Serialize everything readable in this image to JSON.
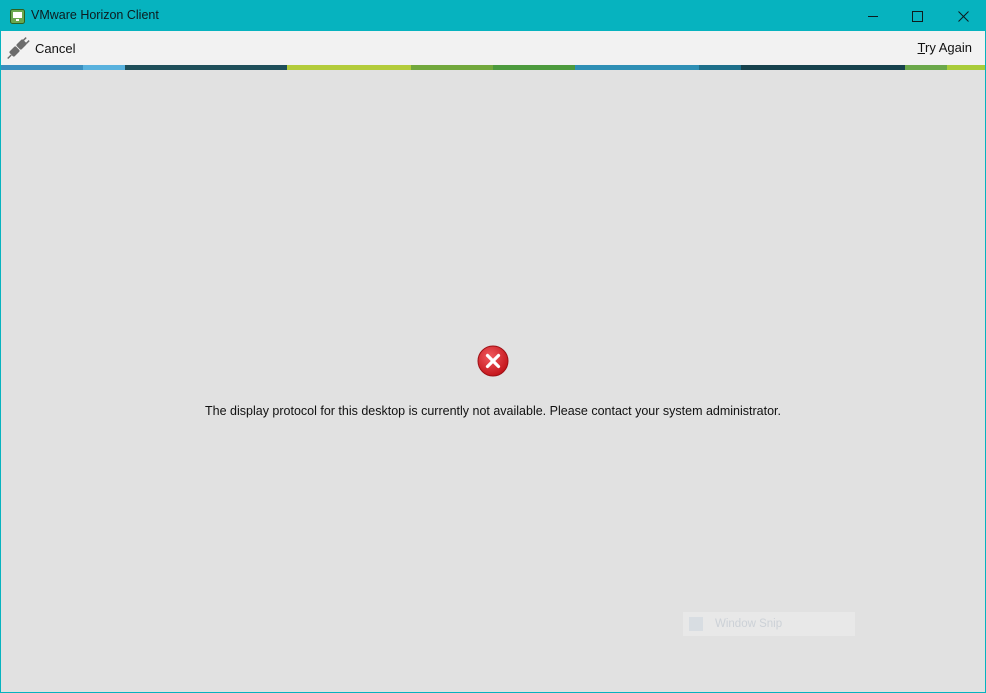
{
  "window": {
    "title": "VMware Horizon Client",
    "icon": "monitor-icon",
    "controls": [
      "minimize-icon",
      "maximize-icon",
      "close-icon"
    ]
  },
  "toolbar": {
    "cancel_label": "Cancel",
    "cancel_icon": "unplug-icon",
    "try_again_mnemonic": "T",
    "try_again_rest": "ry Again"
  },
  "main": {
    "error_icon": "error-x-icon",
    "message": "The display protocol for this desktop is currently not available. Please contact your system administrator."
  },
  "overlay": {
    "label": "Window Snip"
  },
  "colors": {
    "titlebar": "#06b3bf",
    "toolbar": "#f2f2f2",
    "content": "#e1e1e1",
    "error_red": "#e0262b"
  }
}
